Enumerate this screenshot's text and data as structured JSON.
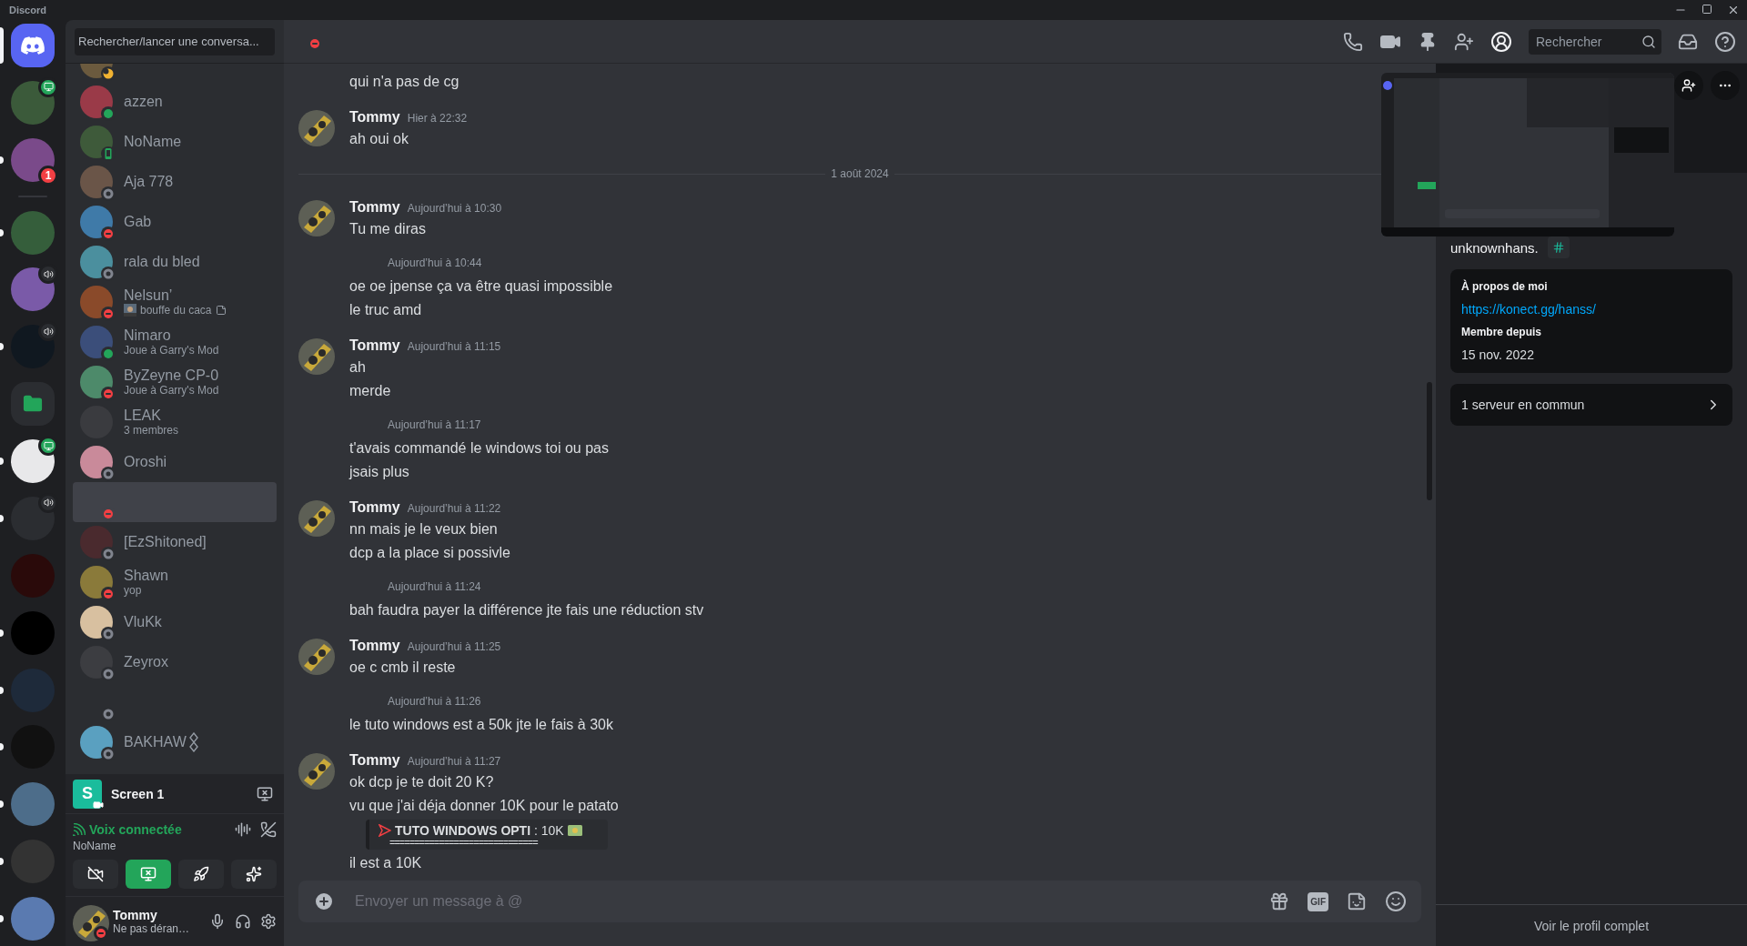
{
  "window": {
    "title": "Discord"
  },
  "rail": {
    "home": {
      "selected": true
    },
    "notifications": [
      {
        "streaming": true,
        "in_voice": false,
        "unread": false
      },
      {
        "streaming": false,
        "in_voice": false,
        "mentions": "1",
        "unread": true
      }
    ],
    "servers": [
      {
        "kind": "server",
        "streaming": false,
        "in_voice": false,
        "unread": true
      },
      {
        "kind": "server",
        "streaming": false,
        "in_voice": true,
        "unread": false
      },
      {
        "kind": "server",
        "streaming": false,
        "in_voice": true,
        "unread": true
      },
      {
        "kind": "folder",
        "streaming": false,
        "in_voice": false,
        "unread": false
      },
      {
        "kind": "server",
        "streaming": true,
        "in_voice": false,
        "unread": true
      },
      {
        "kind": "server",
        "streaming": false,
        "in_voice": true,
        "unread": true
      },
      {
        "kind": "server",
        "streaming": false,
        "in_voice": false,
        "unread": false
      },
      {
        "kind": "server",
        "streaming": false,
        "in_voice": false,
        "unread": true
      },
      {
        "kind": "server",
        "streaming": false,
        "in_voice": false,
        "unread": true
      },
      {
        "kind": "server",
        "streaming": false,
        "in_voice": false,
        "unread": true
      },
      {
        "kind": "server",
        "streaming": false,
        "in_voice": false,
        "unread": true
      },
      {
        "kind": "server",
        "streaming": false,
        "in_voice": false,
        "unread": true
      },
      {
        "kind": "server",
        "streaming": false,
        "in_voice": false,
        "unread": true
      }
    ]
  },
  "dm_search": {
    "placeholder": "Rechercher/lancer une conversa..."
  },
  "dms": [
    {
      "status": {
        "kind": "idle",
        "color": "#f0b232"
      },
      "avatar": true,
      "selected": false
    },
    {
      "name": "azzen",
      "status": {
        "kind": "online",
        "color": "#23a55a"
      },
      "avatar": true,
      "selected": false
    },
    {
      "name": "NoName",
      "status": {
        "kind": "mobile",
        "color": "#23a55a"
      },
      "avatar": true,
      "selected": false
    },
    {
      "name": "Aja 778",
      "status": {
        "kind": "offline",
        "color": "#80848e"
      },
      "avatar": true,
      "selected": false
    },
    {
      "name": "Gab",
      "status": {
        "kind": "dnd",
        "color": "#f23f43"
      },
      "avatar": true,
      "selected": false
    },
    {
      "name": "rala du bled",
      "status": {
        "kind": "offline",
        "color": "#80848e"
      },
      "avatar": true,
      "selected": false
    },
    {
      "name": "Nelsun’",
      "subtitle": {
        "kind": "custom",
        "text": "bouffe du caca"
      },
      "status": {
        "kind": "dnd",
        "color": "#f23f43"
      },
      "avatar": true,
      "selected": false
    },
    {
      "name": "Nimaro",
      "subtitle": {
        "kind": "plain",
        "text": "Joue à Garry's Mod"
      },
      "status": {
        "kind": "online",
        "color": "#23a55a"
      },
      "avatar": true,
      "selected": false
    },
    {
      "name": "ByZeyne CP-0",
      "subtitle": {
        "kind": "plain",
        "text": "Joue à Garry's Mod"
      },
      "status": {
        "kind": "dnd",
        "color": "#f23f43"
      },
      "avatar": true,
      "selected": false
    },
    {
      "name": "LEAK",
      "subtitle": {
        "kind": "plain",
        "text": "3 membres"
      },
      "avatar": true,
      "selected": false
    },
    {
      "name": "Oroshi",
      "status": {
        "kind": "offline",
        "color": "#80848e"
      },
      "avatar": true,
      "selected": false
    },
    {
      "status": {
        "kind": "dnd",
        "color": "#f23f43"
      },
      "avatar": false,
      "selected": true
    },
    {
      "name": "[EzShitoned]",
      "status": {
        "kind": "offline",
        "color": "#80848e"
      },
      "avatar": true,
      "selected": false
    },
    {
      "name": "Shawn",
      "subtitle": {
        "kind": "plain",
        "text": "yop"
      },
      "status": {
        "kind": "dnd",
        "color": "#f23f43"
      },
      "avatar": true,
      "selected": false
    },
    {
      "name": "VluKk",
      "status": {
        "kind": "offline",
        "color": "#80848e"
      },
      "avatar": true,
      "selected": false
    },
    {
      "name": "Zeyrox",
      "status": {
        "kind": "offline",
        "color": "#80848e"
      },
      "avatar": true,
      "selected": false
    },
    {
      "status": {
        "kind": "offline",
        "color": "#80848e"
      },
      "avatar": false,
      "selected": false
    },
    {
      "name": "BAKHAW",
      "decoration": true,
      "status": {
        "kind": "offline",
        "color": "#80848e"
      },
      "avatar": true,
      "selected": false
    }
  ],
  "stream": {
    "app_letter": "S",
    "title": "Screen 1"
  },
  "voice": {
    "status": "Voix connectée",
    "channel": "NoName",
    "buttons": [
      {
        "kind": "camera",
        "on": false
      },
      {
        "kind": "screen",
        "on": true
      },
      {
        "kind": "activity",
        "on": false
      },
      {
        "kind": "soundboard",
        "on": false
      }
    ]
  },
  "user": {
    "name": "Tommy",
    "status_text": "Ne pas déran…",
    "status": {
      "kind": "dnd",
      "color": "#f23f43"
    }
  },
  "chat_header": {
    "status": {
      "kind": "dnd",
      "color": "#f23f43"
    },
    "search_placeholder": "Rechercher"
  },
  "messages": [
    {
      "kind": "plain",
      "lines": [
        {
          "kind": "text",
          "text": "qui n'a pas de cg"
        }
      ]
    },
    {
      "kind": "author",
      "author": "Tommy",
      "time": "Hier à 22:32",
      "lines": [
        {
          "kind": "text",
          "text": "ah oui ok"
        }
      ]
    },
    {
      "kind": "divider",
      "label": "1 août 2024"
    },
    {
      "kind": "author",
      "author": "Tommy",
      "time": "Aujourd’hui à 10:30",
      "lines": [
        {
          "kind": "text",
          "text": "Tu me diras"
        }
      ]
    },
    {
      "kind": "hidden",
      "time": "Aujourd’hui à 10:44",
      "lines": [
        {
          "kind": "text",
          "text": "oe oe jpense ça va être quasi impossible"
        },
        {
          "kind": "text",
          "text": "le truc amd"
        }
      ]
    },
    {
      "kind": "author",
      "author": "Tommy",
      "time": "Aujourd’hui à 11:15",
      "lines": [
        {
          "kind": "text",
          "text": "ah"
        },
        {
          "kind": "text",
          "text": "merde"
        }
      ]
    },
    {
      "kind": "hidden",
      "time": "Aujourd’hui à 11:17",
      "lines": [
        {
          "kind": "text",
          "text": "t'avais commandé le windows toi ou pas"
        },
        {
          "kind": "text",
          "text": "jsais plus"
        }
      ]
    },
    {
      "kind": "author",
      "author": "Tommy",
      "time": "Aujourd’hui à 11:22",
      "lines": [
        {
          "kind": "text",
          "text": "nn mais je le veux bien"
        },
        {
          "kind": "text",
          "text": "dcp a la place si possivle"
        }
      ]
    },
    {
      "kind": "hidden",
      "time": "Aujourd’hui à 11:24",
      "lines": [
        {
          "kind": "text",
          "text": "bah faudra payer la différence jte fais une réduction stv"
        }
      ]
    },
    {
      "kind": "author",
      "author": "Tommy",
      "time": "Aujourd’hui à 11:25",
      "lines": [
        {
          "kind": "text",
          "text": "oe c cmb il reste"
        }
      ]
    },
    {
      "kind": "hidden",
      "time": "Aujourd’hui à 11:26",
      "lines": [
        {
          "kind": "text",
          "text": "le tuto windows est a 50k jte le fais à 30k"
        }
      ]
    },
    {
      "kind": "author",
      "author": "Tommy",
      "time": "Aujourd’hui à 11:27",
      "lines": [
        {
          "kind": "text",
          "text": "ok dcp je te doit 20 K?"
        },
        {
          "kind": "text",
          "text": "vu que j'ai déja donner 10K pour le patato"
        },
        {
          "kind": "embed",
          "title": "**TUTO WINDOWS OPTI** : 10K",
          "rule": "=============================="
        },
        {
          "kind": "text",
          "text": "il est a 10K"
        }
      ]
    }
  ],
  "composer": {
    "placeholder": "Envoyer un message à @",
    "gif_label": "GIF"
  },
  "profile": {
    "username": "unknownhans.",
    "about_title": "À propos de moi",
    "link": "https://konect.gg/hanss/",
    "member_since_title": "Membre depuis",
    "member_since": "15 nov. 2022",
    "mutual": "1 serveur en commun",
    "footer": "Voir le profil complet"
  }
}
